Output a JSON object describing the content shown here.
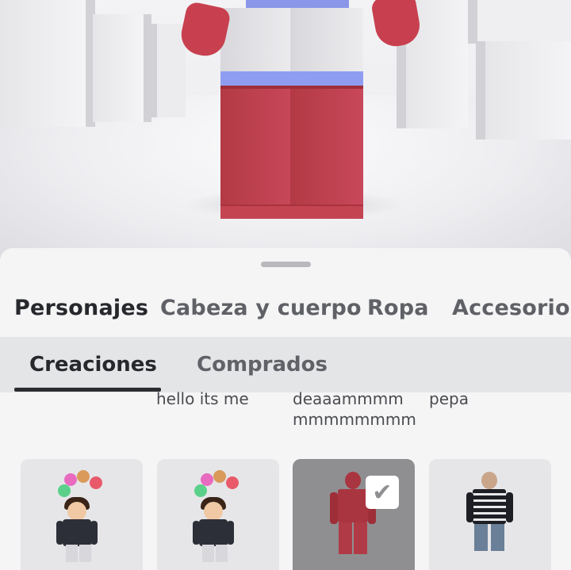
{
  "tabs_main": [
    {
      "label": "Personajes",
      "active": true
    },
    {
      "label": "Cabeza y cuerpo",
      "active": false
    },
    {
      "label": "Ropa",
      "active": false
    },
    {
      "label": "Accesorios",
      "active": false
    }
  ],
  "tabs_sub": [
    {
      "label": "Creaciones",
      "active": true
    },
    {
      "label": "Comprados",
      "active": false
    }
  ],
  "item_names": [
    "hello its me",
    "deaaammmm mmmmmmmm",
    "pepa"
  ],
  "item_name_lines": {
    "second_line1": "deaaammmm",
    "second_line2": "mmmmmmmm"
  },
  "grid_items": [
    {
      "icon": "character-thumbnail-icon",
      "selected": false
    },
    {
      "icon": "character-thumbnail-icon",
      "selected": false
    },
    {
      "icon": "character-thumbnail-icon",
      "selected": true
    },
    {
      "icon": "character-thumbnail-icon",
      "selected": false
    }
  ],
  "selected_mark": "✔",
  "colors": {
    "active_tab": "#26282c",
    "inactive_tab": "#5f6166",
    "selected_card": "#8f8f91",
    "avatar_red": "#c8404f"
  }
}
